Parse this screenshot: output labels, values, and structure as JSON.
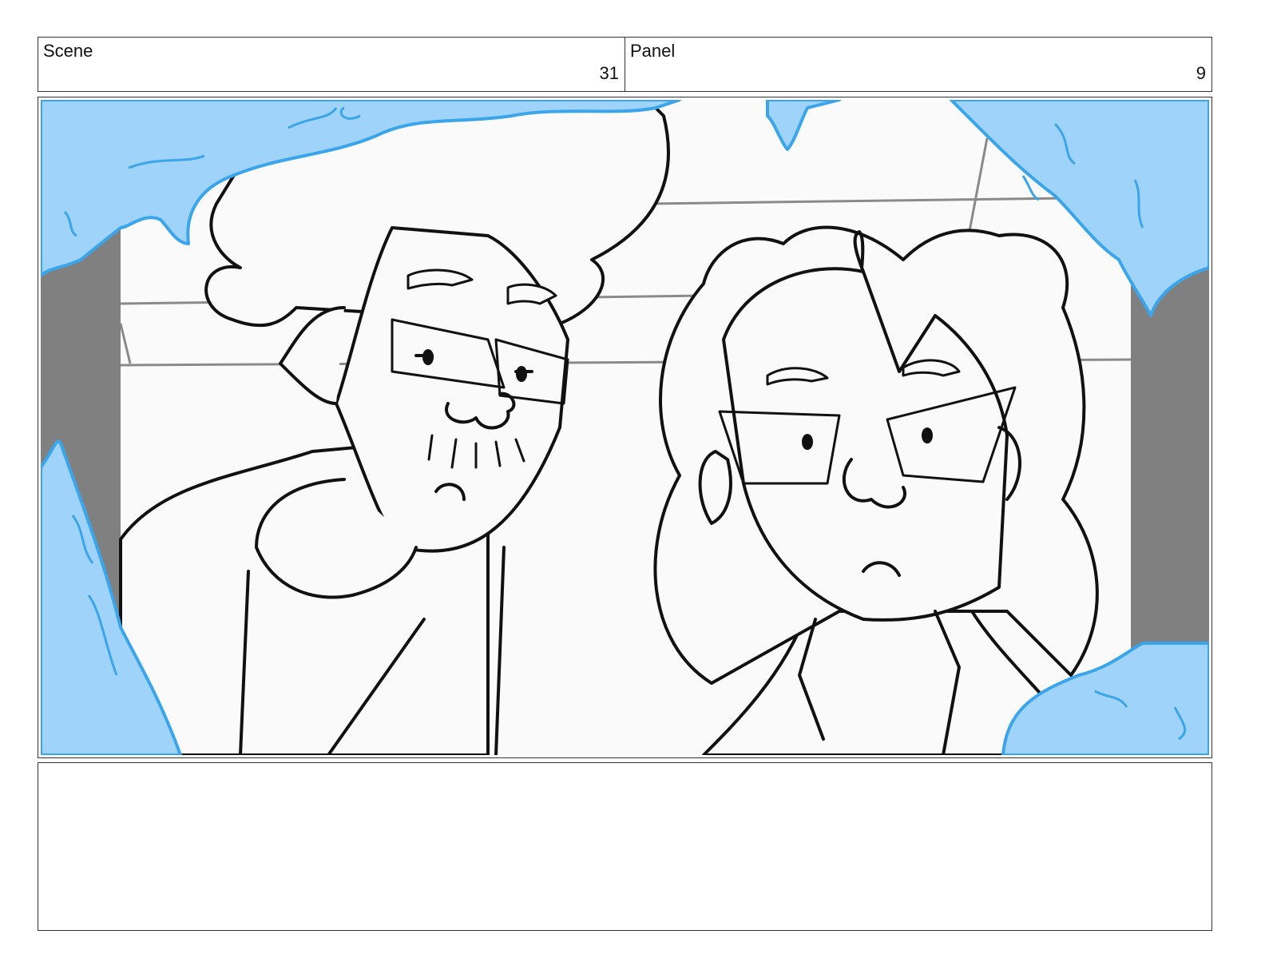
{
  "header": {
    "scene_label": "Scene",
    "scene_number": "31",
    "panel_label": "Panel",
    "panel_number": "9"
  },
  "colors": {
    "ice": "#9fd3f9",
    "ice_edge": "#3aa5ea",
    "wall_shadow": "#808080",
    "line_art": "#111111"
  },
  "notes": {
    "text": ""
  }
}
